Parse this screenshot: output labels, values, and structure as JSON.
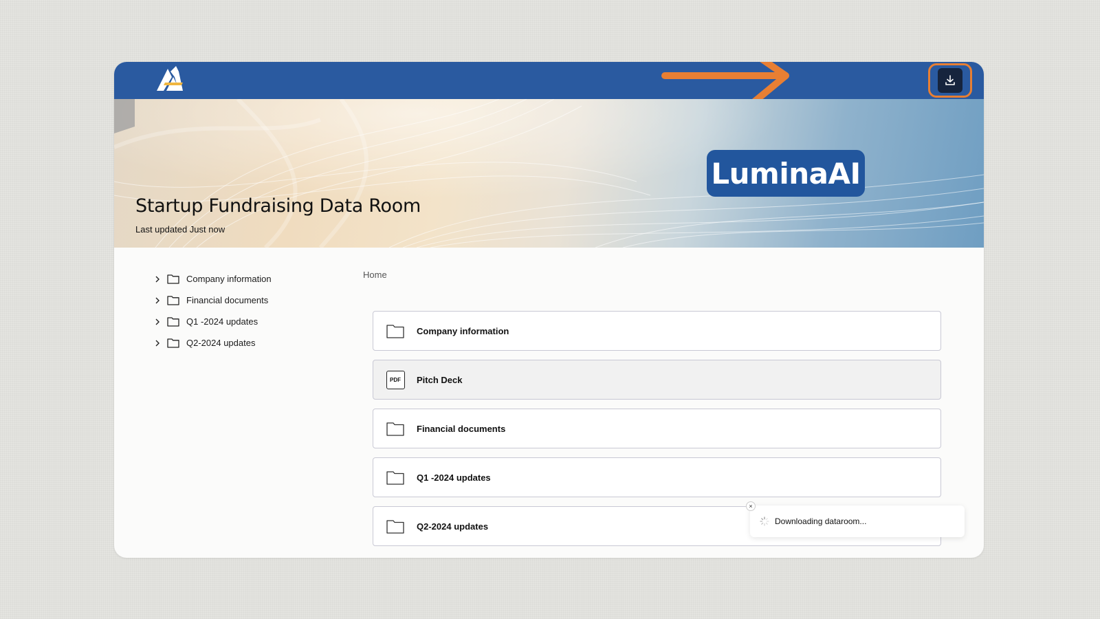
{
  "header": {
    "logo_icon": "lumina-logo",
    "download_icon": "download-icon",
    "annotation_color": "#e87f33"
  },
  "banner": {
    "brand_name": "LuminaAI",
    "title": "Startup Fundraising Data Room",
    "subtitle": "Last updated Just now"
  },
  "sidebar": {
    "items": [
      {
        "label": "Company information"
      },
      {
        "label": "Financial documents"
      },
      {
        "label": "Q1 -2024 updates"
      },
      {
        "label": "Q2-2024 updates"
      }
    ]
  },
  "breadcrumb": {
    "home": "Home"
  },
  "list": {
    "items": [
      {
        "label": "Company information",
        "icon": "folder-icon"
      },
      {
        "label": "Pitch Deck",
        "icon": "pdf-icon",
        "icon_text": "PDF"
      },
      {
        "label": "Financial documents",
        "icon": "folder-icon"
      },
      {
        "label": "Q1 -2024 updates",
        "icon": "folder-icon"
      },
      {
        "label": "Q2-2024 updates",
        "icon": "folder-icon"
      }
    ]
  },
  "toast": {
    "message": "Downloading dataroom...",
    "close": "×"
  },
  "colors": {
    "topbar": "#2a5aa0",
    "brand_badge": "#22569d",
    "download_button": "#16243d"
  }
}
